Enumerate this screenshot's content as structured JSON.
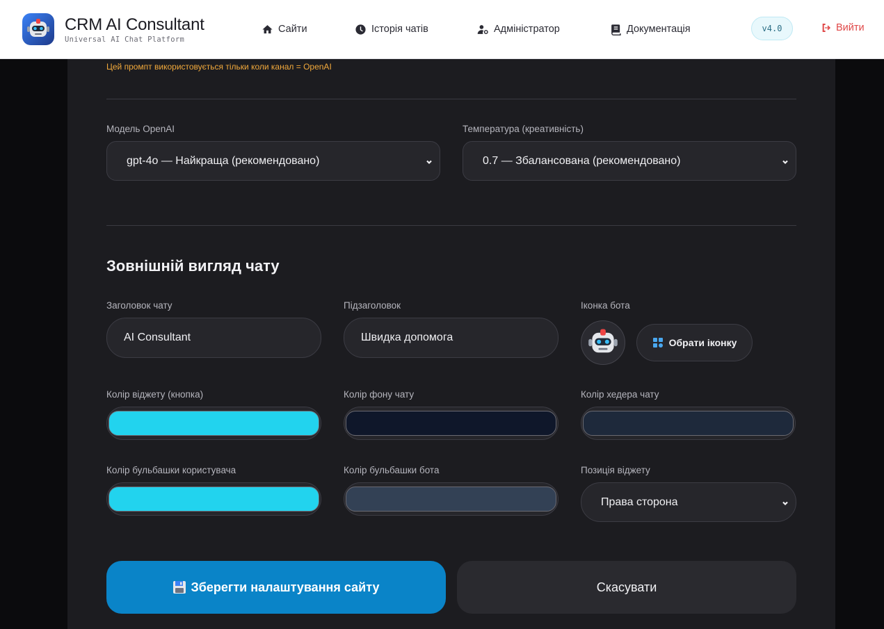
{
  "header": {
    "title": "CRM AI Consultant",
    "subtitle": "Universal AI Chat Platform",
    "nav": [
      {
        "label": "Сайти",
        "icon": "home-icon"
      },
      {
        "label": "Історія чатів",
        "icon": "clock-icon"
      },
      {
        "label": "Адміністратор",
        "icon": "user-gear-icon"
      },
      {
        "label": "Документація",
        "icon": "book-icon"
      }
    ],
    "version": "v4.0",
    "logout": "Вийти"
  },
  "form": {
    "prompt_hint": "Цей промпт використовується тільки коли канал = OpenAI",
    "model": {
      "label": "Модель OpenAI",
      "value": "gpt-4o — Найкраща (рекомендовано)"
    },
    "temperature": {
      "label": "Температура (креативність)",
      "value": "0.7 — Збалансована (рекомендовано)"
    },
    "appearance_title": "Зовнішній вигляд чату",
    "chat_title": {
      "label": "Заголовок чату",
      "value": "AI Consultant"
    },
    "chat_subtitle": {
      "label": "Підзаголовок",
      "value": "Швидка допомога"
    },
    "bot_icon": {
      "label": "Іконка бота",
      "button": "Обрати іконку"
    },
    "widget_color": {
      "label": "Колір віджету (кнопка)",
      "value": "#22d3ee"
    },
    "chat_bg_color": {
      "label": "Колір фону чату",
      "value": "#0f172a"
    },
    "chat_header_color": {
      "label": "Колір хедера чату",
      "value": "#1e293b"
    },
    "user_bubble_color": {
      "label": "Колір бульбашки користувача",
      "value": "#22d3ee"
    },
    "bot_bubble_color": {
      "label": "Колір бульбашки бота",
      "value": "#334155"
    },
    "widget_position": {
      "label": "Позиція віджету",
      "value": "Права сторона"
    },
    "save_button": "Зберегти налаштування сайту",
    "cancel_button": "Скасувати"
  }
}
